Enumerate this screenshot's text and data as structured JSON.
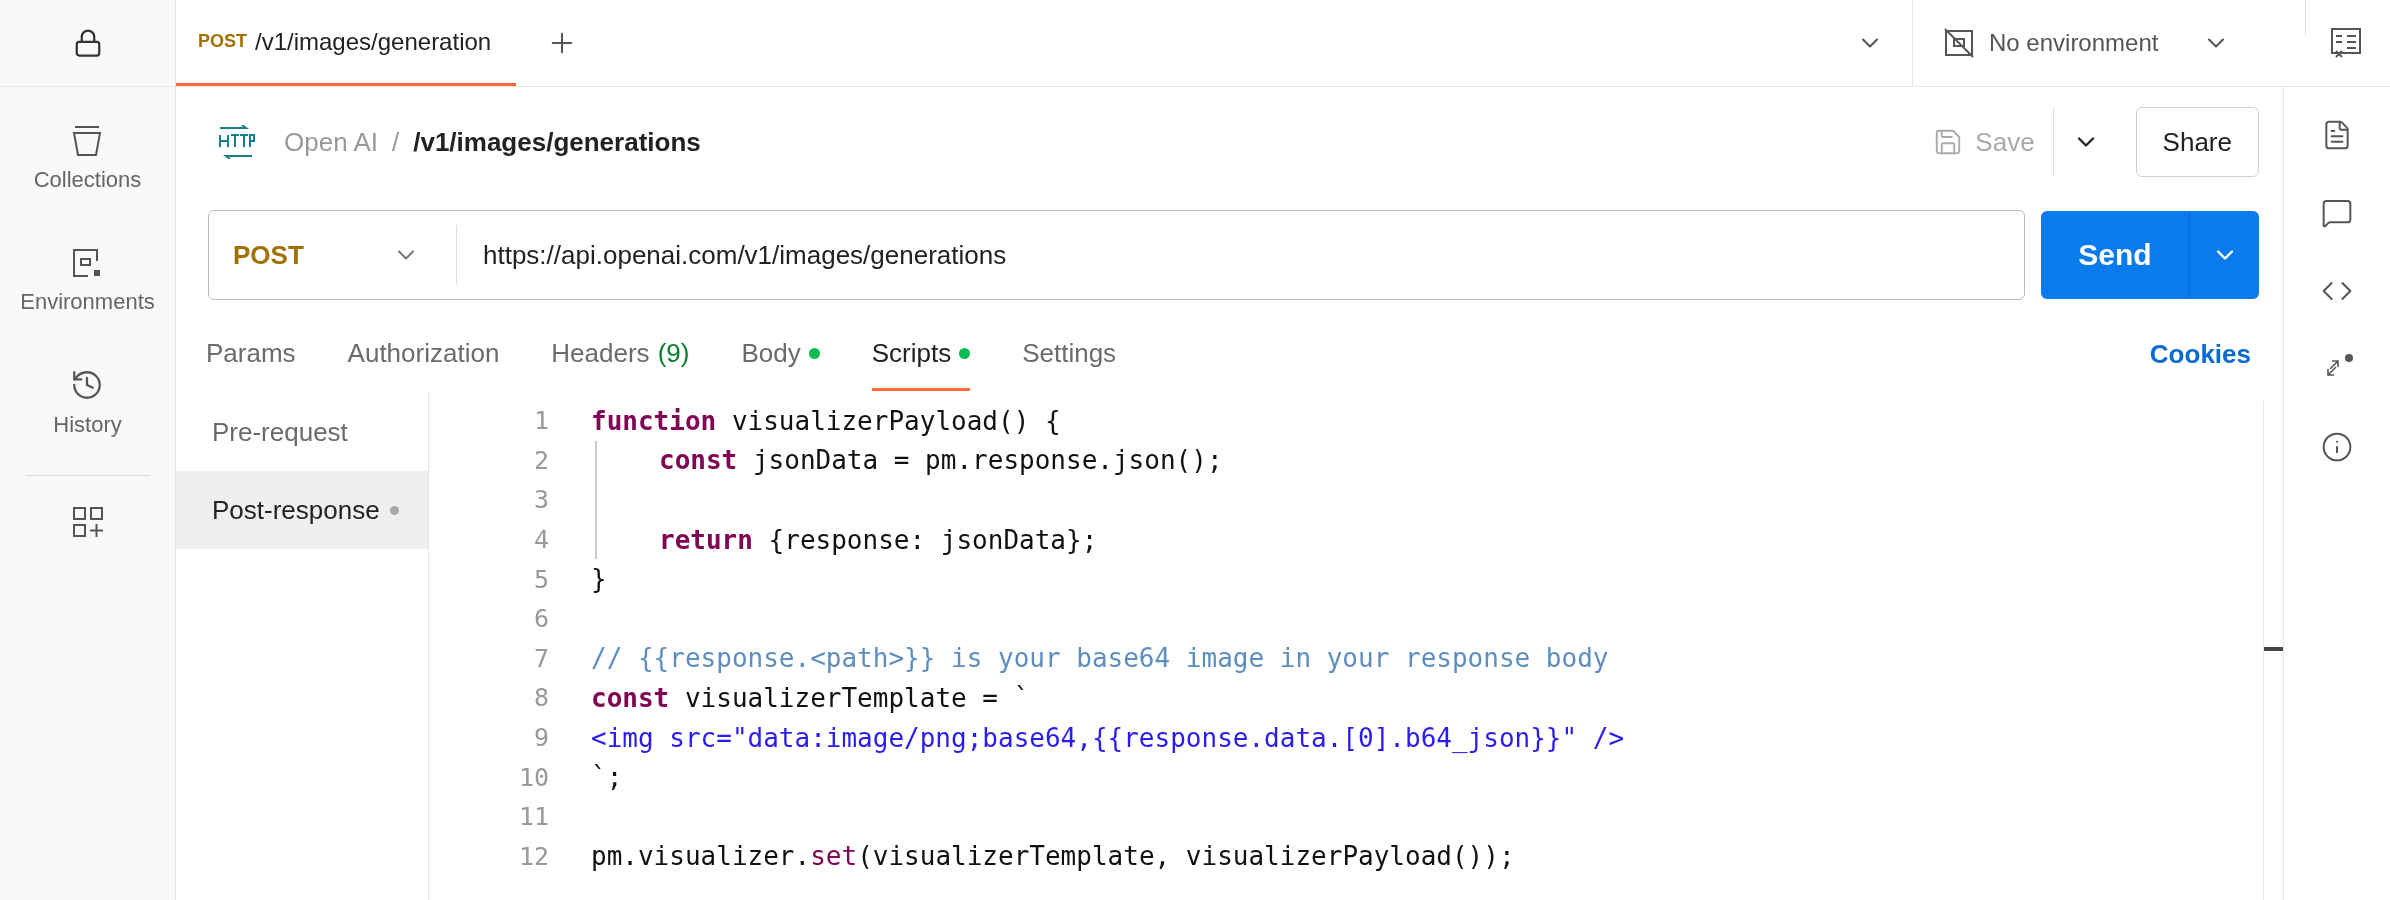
{
  "nav": {
    "items": [
      {
        "label": "Collections",
        "kind": "collections"
      },
      {
        "label": "Environments",
        "kind": "environments"
      },
      {
        "label": "History",
        "kind": "history"
      }
    ]
  },
  "tab": {
    "method": "POST",
    "title": "/v1/images/generation"
  },
  "environment": {
    "label": "No environment"
  },
  "breadcrumb": {
    "collection": "Open AI",
    "separator": "/",
    "request": "/v1/images/generations"
  },
  "actions": {
    "save": "Save",
    "save_disabled": true,
    "share": "Share"
  },
  "request": {
    "method": "POST",
    "url": "https://api.openai.com/v1/images/generations",
    "send": "Send"
  },
  "request_tabs": [
    {
      "label": "Params",
      "selected": false
    },
    {
      "label": "Authorization",
      "selected": false
    },
    {
      "label": "Headers",
      "count": "(9)",
      "selected": false
    },
    {
      "label": "Body",
      "dot": true,
      "selected": false
    },
    {
      "label": "Scripts",
      "dot": true,
      "selected": true
    },
    {
      "label": "Settings",
      "selected": false
    }
  ],
  "cookies": "Cookies",
  "script_tabs": [
    {
      "label": "Pre-request",
      "selected": false,
      "modified": false
    },
    {
      "label": "Post-response",
      "selected": true,
      "modified": true
    }
  ],
  "code": {
    "lines": [
      {
        "number": "1",
        "tokens": [
          {
            "kind": "keyword",
            "text": "function"
          },
          {
            "kind": "plain",
            "text": " visualizerPayload() {"
          }
        ]
      },
      {
        "number": "2",
        "indented": true,
        "tokens": [
          {
            "kind": "keyword",
            "text": "const"
          },
          {
            "kind": "plain",
            "text": " jsonData = pm.response.json();"
          }
        ]
      },
      {
        "number": "3",
        "indented": true
      },
      {
        "number": "4",
        "indented": true,
        "tokens": [
          {
            "kind": "keyword",
            "text": "return"
          },
          {
            "kind": "plain",
            "text": " {response: jsonData};"
          }
        ]
      },
      {
        "number": "5",
        "tokens": [
          {
            "kind": "plain",
            "text": "}"
          }
        ]
      },
      {
        "number": "6"
      },
      {
        "number": "7",
        "tokens": [
          {
            "kind": "comment",
            "text": "// {{response.<path>}} is your base64 image in your response body"
          }
        ]
      },
      {
        "number": "8",
        "tokens": [
          {
            "kind": "keyword",
            "text": "const"
          },
          {
            "kind": "plain",
            "text": " visualizerTemplate = `"
          }
        ]
      },
      {
        "number": "9",
        "tokens": [
          {
            "kind": "string",
            "text": "<img src=\"data:image/png;base64,{{response.data.[0].b64_json}}\" />"
          }
        ]
      },
      {
        "number": "10",
        "tokens": [
          {
            "kind": "plain",
            "text": "`;"
          }
        ]
      },
      {
        "number": "11"
      },
      {
        "number": "12",
        "tokens": [
          {
            "kind": "plain",
            "text": "pm.visualizer."
          },
          {
            "kind": "method",
            "text": "set"
          },
          {
            "kind": "plain",
            "text": "(visualizerTemplate, visualizerPayload());"
          }
        ]
      }
    ]
  }
}
